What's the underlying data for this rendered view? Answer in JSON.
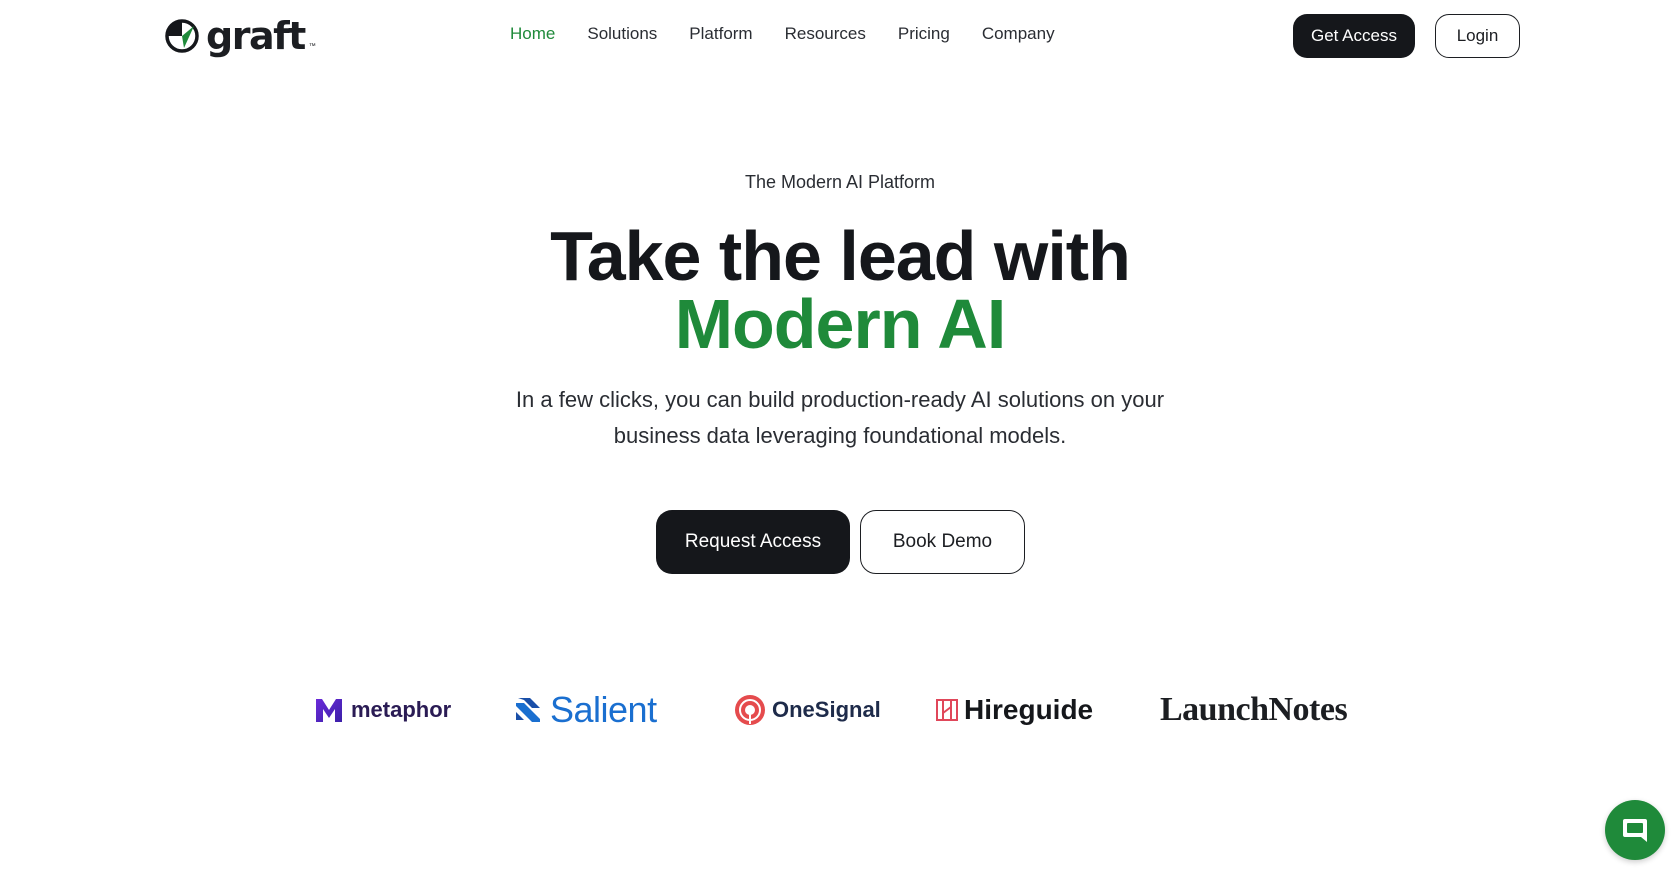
{
  "brand": {
    "name": "graft",
    "trademark": "™",
    "accent_color": "#1f8a3a",
    "dark_color": "#15171b"
  },
  "nav": {
    "links": [
      {
        "label": "Home",
        "active": true
      },
      {
        "label": "Solutions",
        "active": false
      },
      {
        "label": "Platform",
        "active": false
      },
      {
        "label": "Resources",
        "active": false
      },
      {
        "label": "Pricing",
        "active": false
      },
      {
        "label": "Company",
        "active": false
      }
    ],
    "get_access_label": "Get Access",
    "login_label": "Login"
  },
  "hero": {
    "eyebrow": "The Modern AI Platform",
    "title_line1": "Take the lead with",
    "title_line2": "Modern AI",
    "subtitle": "In a few clicks, you can build production-ready AI solutions on your business data leveraging foundational models.",
    "request_access_label": "Request Access",
    "book_demo_label": "Book Demo"
  },
  "customer_logos": [
    {
      "name": "metaphor",
      "icon": "metaphor-logo-icon"
    },
    {
      "name": "Salient",
      "icon": "salient-logo-icon"
    },
    {
      "name": "OneSignal",
      "icon": "onesignal-logo-icon"
    },
    {
      "name": "Hireguide",
      "icon": "hireguide-logo-icon"
    },
    {
      "name": "LaunchNotes",
      "icon": null
    }
  ],
  "chat_widget": {
    "icon": "chat-bubble-icon"
  }
}
